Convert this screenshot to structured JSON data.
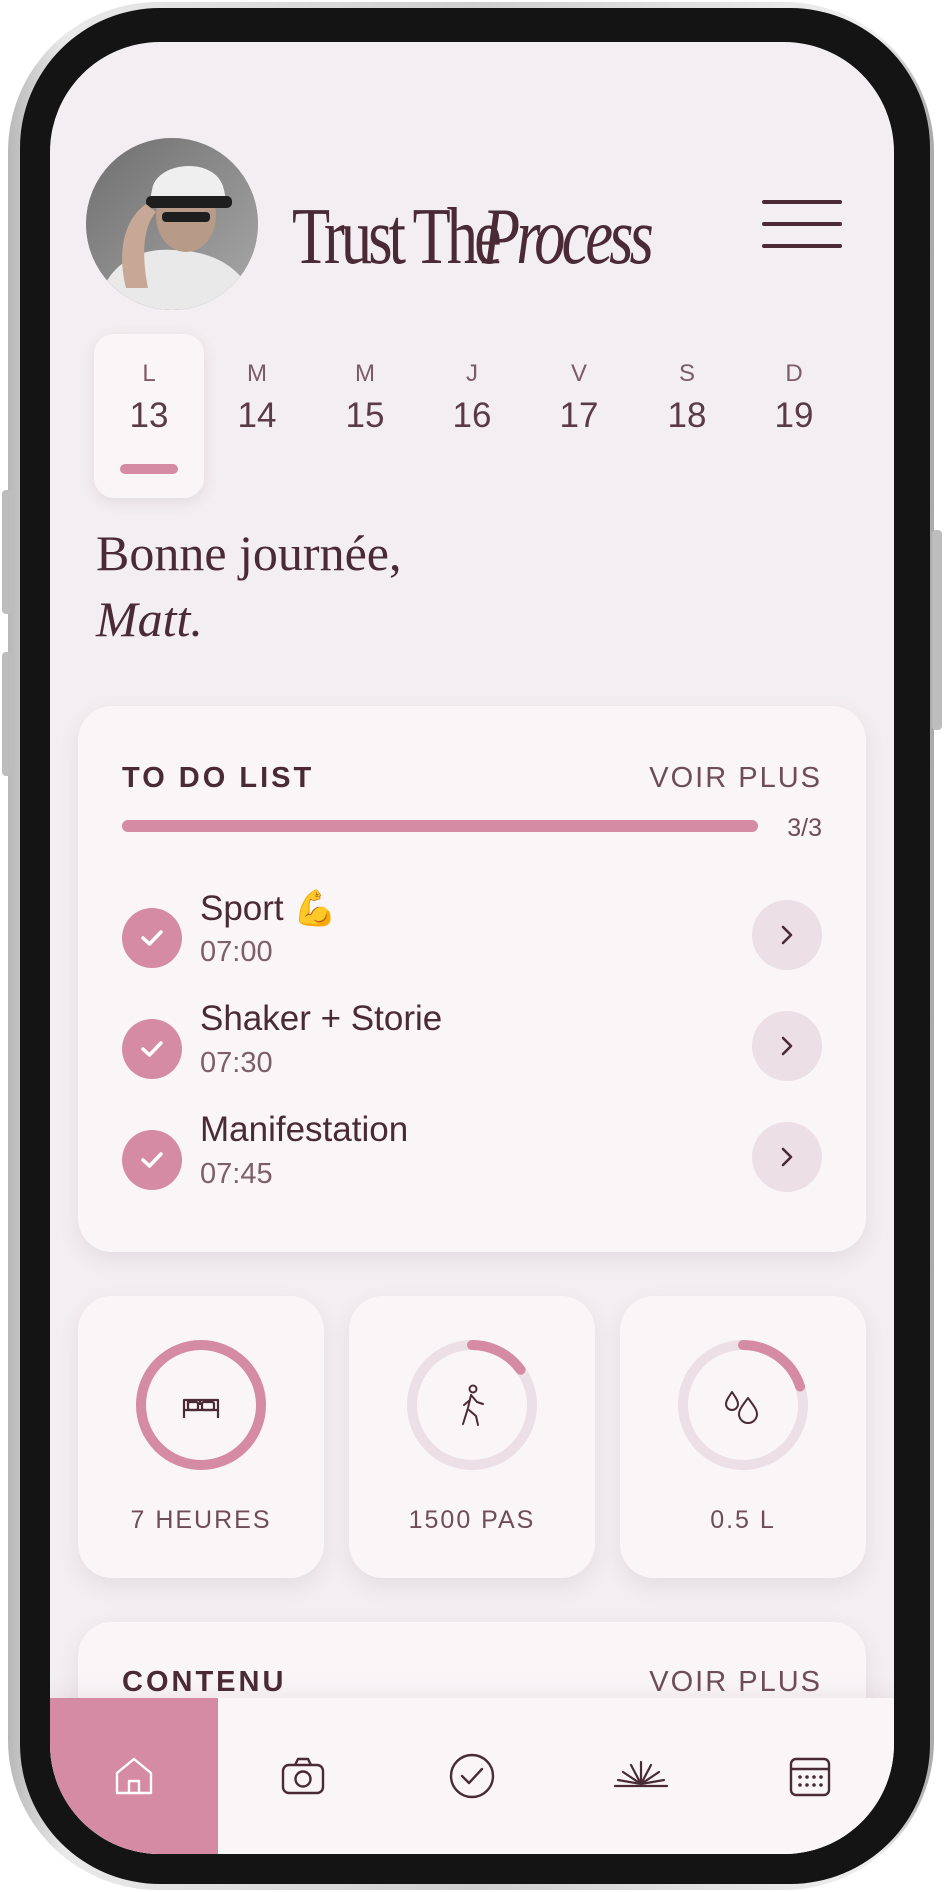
{
  "header": {
    "title_part1": "Trust The",
    "title_part2": "Process"
  },
  "week": [
    {
      "letter": "L",
      "date": "13",
      "selected": true
    },
    {
      "letter": "M",
      "date": "14",
      "selected": false
    },
    {
      "letter": "M",
      "date": "15",
      "selected": false
    },
    {
      "letter": "J",
      "date": "16",
      "selected": false
    },
    {
      "letter": "V",
      "date": "17",
      "selected": false
    },
    {
      "letter": "S",
      "date": "18",
      "selected": false
    },
    {
      "letter": "D",
      "date": "19",
      "selected": false
    }
  ],
  "greeting": {
    "line1": "Bonne journée,",
    "name": "Matt."
  },
  "todo": {
    "title": "TO DO LIST",
    "more": "VOIR PLUS",
    "progress_text": "3/3",
    "progress": 1.0,
    "tasks": [
      {
        "title": "Sport 💪",
        "time": "07:00",
        "done": true
      },
      {
        "title": "Shaker + Storie",
        "time": "07:30",
        "done": true
      },
      {
        "title": "Manifestation",
        "time": "07:45",
        "done": true
      }
    ]
  },
  "stats": [
    {
      "icon": "bed-icon",
      "label": "7 HEURES",
      "progress": 1.0
    },
    {
      "icon": "walking-icon",
      "label": "1500 PAS",
      "progress": 0.15
    },
    {
      "icon": "water-drops-icon",
      "label": "0.5 L",
      "progress": 0.2
    }
  ],
  "content": {
    "title": "CONTENU",
    "more": "VOIR PLUS"
  },
  "nav": [
    {
      "icon": "home-icon",
      "active": true
    },
    {
      "icon": "camera-icon",
      "active": false
    },
    {
      "icon": "check-circle-icon",
      "active": false
    },
    {
      "icon": "sunrise-icon",
      "active": false
    },
    {
      "icon": "calendar-icon",
      "active": false
    }
  ],
  "colors": {
    "accent": "#d58ba3",
    "text": "#4a2a35",
    "background": "#f3eef1",
    "card": "#faf6f8",
    "track": "#ecdfe5"
  }
}
